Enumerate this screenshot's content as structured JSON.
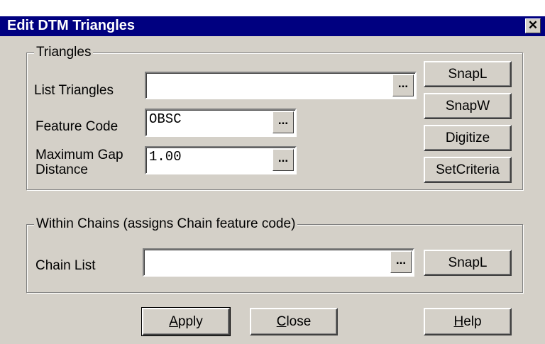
{
  "window": {
    "title": "Edit DTM Triangles",
    "close_symbol": "✕"
  },
  "triangles_group": {
    "legend": "Triangles",
    "list_triangles": {
      "label": "List Triangles",
      "value": "",
      "browse": "..."
    },
    "feature_code": {
      "label": "Feature Code",
      "value": "OBSC",
      "browse": "..."
    },
    "max_gap": {
      "label_line1": "Maximum Gap",
      "label_line2": "Distance",
      "value": "1.00",
      "browse": "..."
    },
    "buttons": {
      "snapl": "SnapL",
      "snapw": "SnapW",
      "digitize": "Digitize",
      "setcriteria": "SetCriteria"
    }
  },
  "chains_group": {
    "legend": "Within Chains (assigns Chain feature code)",
    "chain_list": {
      "label": "Chain List",
      "value": "",
      "browse": "..."
    },
    "snapl": "SnapL"
  },
  "footer": {
    "apply": {
      "mnemonic": "A",
      "rest": "pply"
    },
    "close": {
      "mnemonic": "C",
      "rest": "lose"
    },
    "help": {
      "mnemonic": "H",
      "rest": "elp"
    }
  }
}
